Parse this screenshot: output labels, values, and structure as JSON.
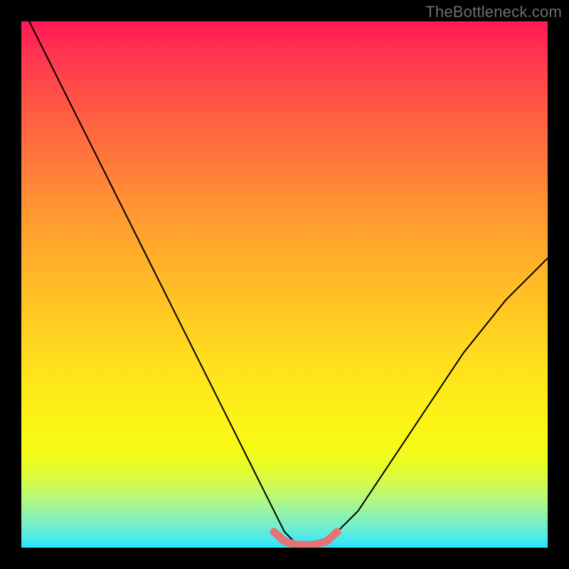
{
  "watermark": "TheBottleneck.com",
  "colors": {
    "frame": "#000000",
    "curve": "#000000",
    "marker": "#e57373",
    "gradient_top": "#ff1955",
    "gradient_bottom": "#24e5fe"
  },
  "chart_data": {
    "type": "line",
    "title": "",
    "xlabel": "",
    "ylabel": "",
    "xlim": [
      0,
      100
    ],
    "ylim": [
      0,
      100
    ],
    "grid": false,
    "legend": false,
    "x": [
      0,
      4,
      8,
      12,
      16,
      20,
      24,
      28,
      32,
      36,
      40,
      44,
      48,
      50,
      52,
      54,
      56,
      58,
      60,
      64,
      68,
      72,
      76,
      80,
      84,
      88,
      92,
      96,
      100
    ],
    "values": [
      103,
      95,
      87,
      79,
      71,
      63,
      55,
      47,
      39,
      31,
      23,
      15,
      7,
      3,
      1,
      0.5,
      0.5,
      1,
      3,
      7,
      13,
      19,
      25,
      31,
      37,
      42,
      47,
      51,
      55
    ],
    "marker_segment": {
      "x": [
        48,
        50,
        52,
        54,
        56,
        58,
        60
      ],
      "y": [
        3,
        1.2,
        0.6,
        0.5,
        0.6,
        1.2,
        3
      ]
    },
    "note": "Values are approximate, read from the plot. y=0 is the bottom edge; y=100 is the top edge. The left branch descends roughly linearly from ~103 (clipped above frame) to ~0.5 near x≈54; the right branch rises with decreasing slope to ~55 at x=100. The salmon marker segment traces the curve bottom from x≈48 to x≈60."
  }
}
